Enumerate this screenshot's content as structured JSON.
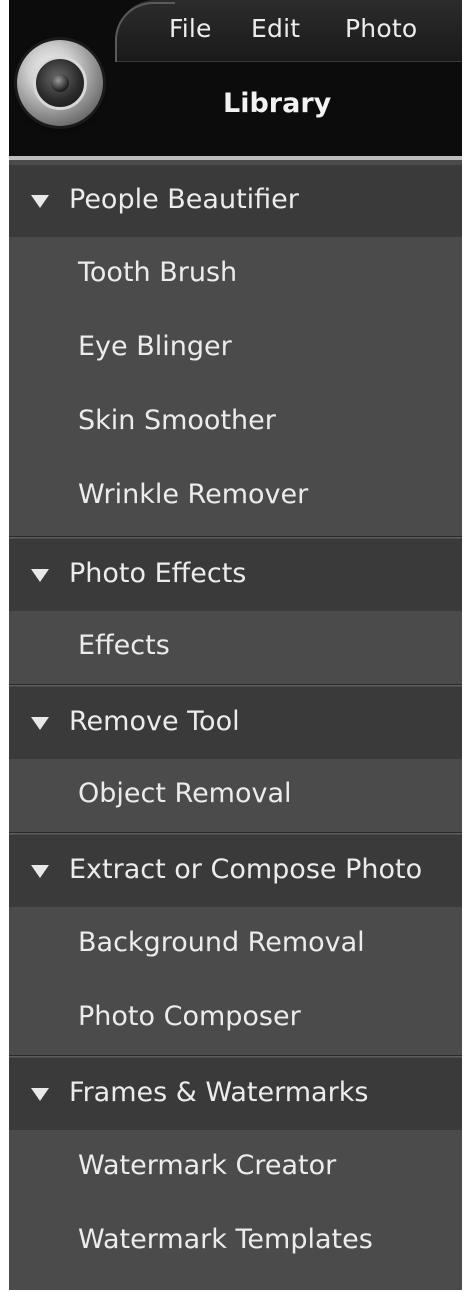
{
  "menu": {
    "file": "File",
    "edit": "Edit",
    "photo": "Photo"
  },
  "logo_icon": "camera-lens-icon",
  "library_title": "Library",
  "colors": {
    "panel_bg": "#4b4b4b",
    "section_header_bg": "#3a3a3a",
    "header_bg": "#0c0c0c",
    "text": "#ececec"
  },
  "sections": [
    {
      "title": "People Beautifier",
      "icon": "triangle-down-icon",
      "items": [
        "Tooth Brush",
        "Eye Blinger",
        "Skin Smoother",
        "Wrinkle Remover"
      ]
    },
    {
      "title": "Photo Effects",
      "icon": "triangle-down-icon",
      "items": [
        "Effects"
      ]
    },
    {
      "title": "Remove Tool",
      "icon": "triangle-down-icon",
      "items": [
        "Object Removal"
      ]
    },
    {
      "title": "Extract or Compose Photo",
      "icon": "triangle-down-icon",
      "items": [
        "Background Removal",
        "Photo Composer"
      ]
    },
    {
      "title": "Frames & Watermarks",
      "icon": "triangle-down-icon",
      "items": [
        "Watermark Creator",
        "Watermark Templates"
      ]
    }
  ]
}
